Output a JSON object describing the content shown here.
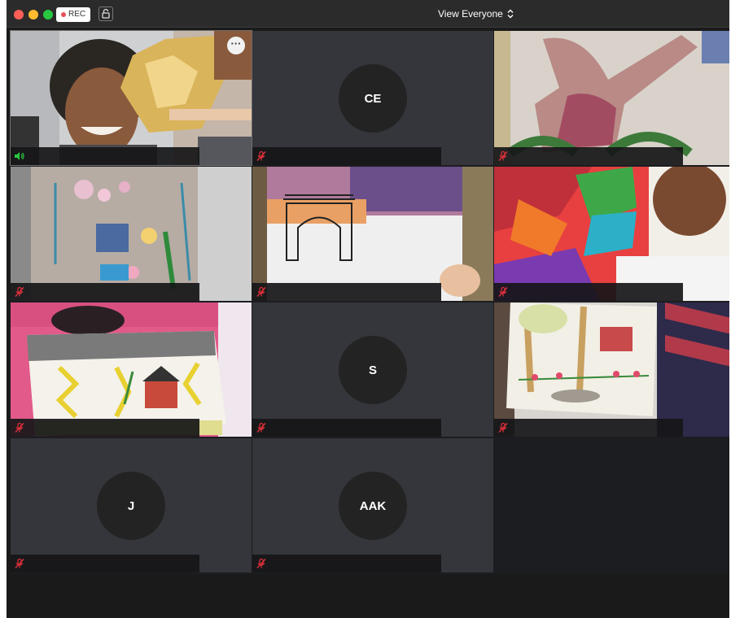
{
  "window": {
    "rec_label": "REC",
    "view_label": "View Everyone",
    "colors": {
      "rec_dot": "#e8505b",
      "muted_icon": "#e0303a",
      "speaking_icon": "#28c840"
    }
  },
  "participants": [
    {
      "id": "p1",
      "video": true,
      "mic": "speaking",
      "content": "woman holding up gold paper crown",
      "more_label": "···"
    },
    {
      "id": "p2",
      "video": false,
      "initials": "CE",
      "mic": "muted"
    },
    {
      "id": "p3",
      "video": true,
      "mic": "muted",
      "content": "painting of a figure"
    },
    {
      "id": "p4",
      "video": true,
      "mic": "muted",
      "content": "collage of flowers on a body outline"
    },
    {
      "id": "p5",
      "video": true,
      "mic": "muted",
      "content": "drawing of an arch"
    },
    {
      "id": "p6",
      "video": true,
      "mic": "muted",
      "content": "colorful painting"
    },
    {
      "id": "p7",
      "video": true,
      "mic": "muted",
      "content": "sketchbook drawing of house and lightning"
    },
    {
      "id": "p8",
      "video": false,
      "initials": "S",
      "mic": "muted"
    },
    {
      "id": "p9",
      "video": true,
      "mic": "muted",
      "content": "drawing of trees and flowers"
    },
    {
      "id": "p10",
      "video": false,
      "initials": "J",
      "mic": "muted"
    },
    {
      "id": "p11",
      "video": false,
      "initials": "AAK",
      "mic": "muted"
    }
  ]
}
